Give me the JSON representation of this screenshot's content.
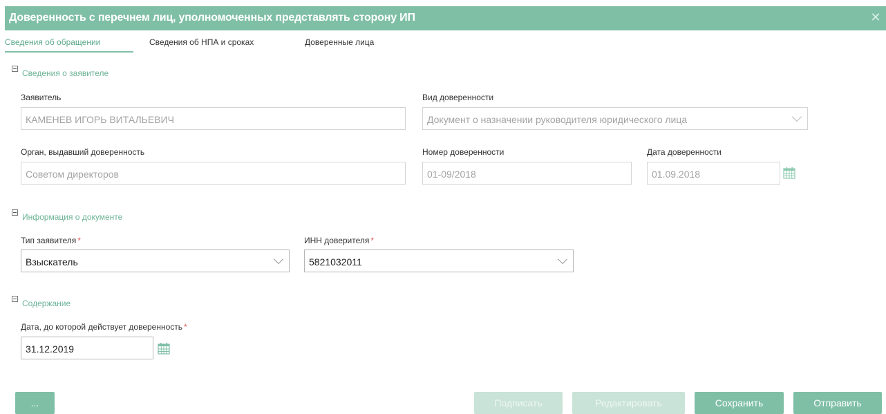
{
  "dialog": {
    "title": "Доверенность с перечнем лиц, уполномоченных представлять сторону ИП"
  },
  "tabs": [
    {
      "label": "Сведения об обращении"
    },
    {
      "label": "Сведения об НПА и сроках"
    },
    {
      "label": "Доверенные лица"
    }
  ],
  "sections": {
    "applicant": {
      "title": "Сведения о заявителе",
      "applicant_label": "Заявитель",
      "applicant_value": "КАМЕНЕВ ИГОРЬ ВИТАЛЬЕВИЧ",
      "poa_type_label": "Вид доверенности",
      "poa_type_value": "Документ о назначении руководителя юридического лица",
      "issuer_label": "Орган, выдавший доверенность",
      "issuer_value": "Советом директоров",
      "poa_number_label": "Номер доверенности",
      "poa_number_value": "01-09/2018",
      "poa_date_label": "Дата доверенности",
      "poa_date_value": "01.09.2018"
    },
    "document": {
      "title": "Информация о документе",
      "applicant_type_label": "Тип заявителя",
      "applicant_type_value": "Взыскатель",
      "inn_label": "ИНН доверителя",
      "inn_value": "5821032011"
    },
    "content": {
      "title": "Содержание",
      "valid_until_label": "Дата, до которой действует доверенность",
      "valid_until_value": "31.12.2019"
    }
  },
  "buttons": {
    "more": "...",
    "sign": "Подписать",
    "edit": "Редактировать",
    "save": "Сохранить",
    "send": "Отправить"
  },
  "required_mark": "*",
  "colors": {
    "accent": "#7fbfa6",
    "accent_text": "#6db397",
    "required": "#e05a5a",
    "disabled": "#c9e3d8"
  }
}
